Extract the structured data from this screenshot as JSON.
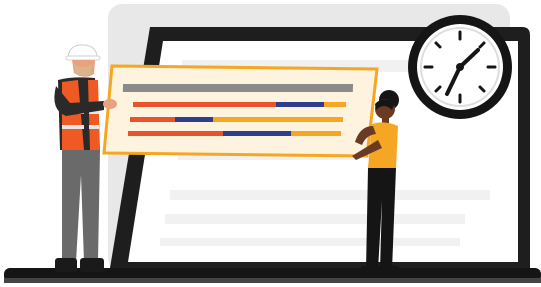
{
  "colors": {
    "background": "#ffffff",
    "laptop_body": "#1e1e1e",
    "laptop_screen": "#ffffff",
    "back_panel": "#e6e6e6",
    "board_border": "#f5a623",
    "board_fill": "#fdf2dc",
    "bar_orange": "#e8532b",
    "bar_blue": "#2f3d8f",
    "bar_amber": "#f5a623",
    "clock_face": "#ffffff",
    "clock_ink": "#151515",
    "vest_orange": "#ef5a24",
    "shirt_orange": "#f5a623"
  },
  "clock": {
    "hour": 1,
    "minute": 8
  },
  "icons": {
    "clock": "clock-icon",
    "laptop": "laptop-icon"
  },
  "people": [
    {
      "role": "construction-worker",
      "holds": "gantt-board"
    },
    {
      "role": "woman-in-orange-shirt",
      "holds": "gantt-board"
    }
  ]
}
